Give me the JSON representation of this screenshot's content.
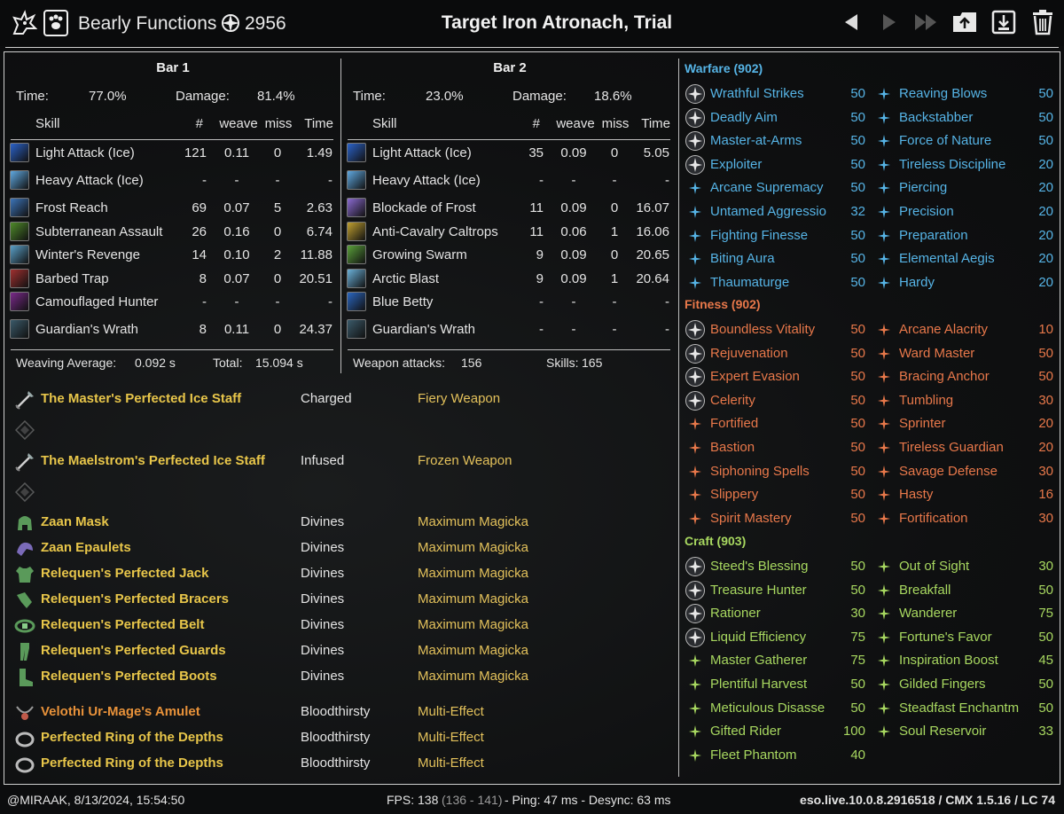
{
  "header": {
    "character": "Bearly Functions",
    "cp": "2956",
    "title": "Target Iron Atronach, Trial"
  },
  "bars": [
    {
      "title": "Bar 1",
      "time_label": "Time:",
      "time": "77.0%",
      "damage_label": "Damage:",
      "damage": "81.4%",
      "cols": [
        "Skill",
        "#",
        "weave",
        "miss",
        "Time"
      ],
      "skills": [
        {
          "name": "Light Attack (Ice)",
          "n": "121",
          "weave": "0.11",
          "miss": "0",
          "time": "1.49",
          "color": "#2b62c9"
        },
        {
          "name": "Heavy Attack (Ice)",
          "n": "-",
          "weave": "-",
          "miss": "-",
          "time": "-",
          "color": "#5fa8e0"
        },
        {
          "name": "Frost Reach",
          "n": "69",
          "weave": "0.07",
          "miss": "5",
          "time": "2.63",
          "color": "#3c74b8"
        },
        {
          "name": "Subterranean Assault",
          "n": "26",
          "weave": "0.16",
          "miss": "0",
          "time": "6.74",
          "color": "#4f8a2a"
        },
        {
          "name": "Winter's Revenge",
          "n": "14",
          "weave": "0.10",
          "miss": "2",
          "time": "11.88",
          "color": "#5aa0c8"
        },
        {
          "name": "Barbed Trap",
          "n": "8",
          "weave": "0.07",
          "miss": "0",
          "time": "20.51",
          "color": "#a03030"
        },
        {
          "name": "Camouflaged Hunter",
          "n": "-",
          "weave": "-",
          "miss": "-",
          "time": "-",
          "color": "#7a2a8a"
        },
        {
          "name": "Guardian's Wrath",
          "n": "8",
          "weave": "0.11",
          "miss": "0",
          "time": "24.37",
          "color": "#3a5a6a"
        }
      ],
      "foot_left_label": "Weaving Average:",
      "foot_left": "0.092 s",
      "foot_right_label": "Total:",
      "foot_right": "15.094 s"
    },
    {
      "title": "Bar 2",
      "time_label": "Time:",
      "time": "23.0%",
      "damage_label": "Damage:",
      "damage": "18.6%",
      "cols": [
        "Skill",
        "#",
        "weave",
        "miss",
        "Time"
      ],
      "skills": [
        {
          "name": "Light Attack (Ice)",
          "n": "35",
          "weave": "0.09",
          "miss": "0",
          "time": "5.05",
          "color": "#2b62c9"
        },
        {
          "name": "Heavy Attack (Ice)",
          "n": "-",
          "weave": "-",
          "miss": "-",
          "time": "-",
          "color": "#5fa8e0"
        },
        {
          "name": "Blockade of Frost",
          "n": "11",
          "weave": "0.09",
          "miss": "0",
          "time": "16.07",
          "color": "#8a6ad0"
        },
        {
          "name": "Anti-Cavalry Caltrops",
          "n": "11",
          "weave": "0.06",
          "miss": "1",
          "time": "16.06",
          "color": "#c0a030"
        },
        {
          "name": "Growing Swarm",
          "n": "9",
          "weave": "0.09",
          "miss": "0",
          "time": "20.65",
          "color": "#5aa03a"
        },
        {
          "name": "Arctic Blast",
          "n": "9",
          "weave": "0.09",
          "miss": "1",
          "time": "20.64",
          "color": "#6ab0d8"
        },
        {
          "name": "Blue Betty",
          "n": "-",
          "weave": "-",
          "miss": "-",
          "time": "-",
          "color": "#2a66c0"
        },
        {
          "name": "Guardian's Wrath",
          "n": "-",
          "weave": "-",
          "miss": "-",
          "time": "-",
          "color": "#3a5a6a"
        }
      ],
      "foot_left_label": "Weapon attacks:",
      "foot_left": "156",
      "foot_right_label": "Skills:",
      "foot_right": "165"
    }
  ],
  "gear": [
    {
      "name": "The Master's Perfected Ice Staff",
      "trait": "Charged",
      "ench": "Fiery Weapon",
      "icon": "staff-icon"
    },
    {
      "name": "The Maelstrom's Perfected Ice Staff",
      "trait": "Infused",
      "ench": "Frozen Weapon",
      "icon": "staff-icon"
    },
    {
      "name": "Zaan Mask",
      "trait": "Divines",
      "ench": "Maximum Magicka",
      "icon": "helm-icon"
    },
    {
      "name": "Zaan Epaulets",
      "trait": "Divines",
      "ench": "Maximum Magicka",
      "icon": "shoulder-icon"
    },
    {
      "name": "Relequen's Perfected Jack",
      "trait": "Divines",
      "ench": "Maximum Magicka",
      "icon": "chest-icon"
    },
    {
      "name": "Relequen's Perfected Bracers",
      "trait": "Divines",
      "ench": "Maximum Magicka",
      "icon": "bracers-icon"
    },
    {
      "name": "Relequen's Perfected Belt",
      "trait": "Divines",
      "ench": "Maximum Magicka",
      "icon": "belt-icon"
    },
    {
      "name": "Relequen's Perfected Guards",
      "trait": "Divines",
      "ench": "Maximum Magicka",
      "icon": "legs-icon"
    },
    {
      "name": "Relequen's Perfected Boots",
      "trait": "Divines",
      "ench": "Maximum Magicka",
      "icon": "boots-icon"
    },
    {
      "name": "Velothi Ur-Mage's Amulet",
      "trait": "Bloodthirsty",
      "ench": "Multi-Effect",
      "icon": "amulet-icon"
    },
    {
      "name": "Perfected Ring of the Depths",
      "trait": "Bloodthirsty",
      "ench": "Multi-Effect",
      "icon": "ring-icon"
    },
    {
      "name": "Perfected Ring of the Depths",
      "trait": "Bloodthirsty",
      "ench": "Multi-Effect",
      "icon": "ring-icon"
    }
  ],
  "cp_trees": [
    {
      "title": "Warfare (902)",
      "color": "#56b4e6",
      "left": [
        {
          "name": "Wrathful Strikes",
          "v": "50",
          "slotted": true
        },
        {
          "name": "Deadly Aim",
          "v": "50",
          "slotted": true
        },
        {
          "name": "Master-at-Arms",
          "v": "50",
          "slotted": true
        },
        {
          "name": "Exploiter",
          "v": "50",
          "slotted": true
        },
        {
          "name": "Arcane Supremacy",
          "v": "50",
          "slotted": false
        },
        {
          "name": "Untamed Aggressio",
          "v": "32",
          "slotted": false
        },
        {
          "name": "Fighting Finesse",
          "v": "50",
          "slotted": false
        },
        {
          "name": "Biting Aura",
          "v": "50",
          "slotted": false
        },
        {
          "name": "Thaumaturge",
          "v": "50",
          "slotted": false
        }
      ],
      "right": [
        {
          "name": "Reaving Blows",
          "v": "50"
        },
        {
          "name": "Backstabber",
          "v": "50"
        },
        {
          "name": "Force of Nature",
          "v": "50"
        },
        {
          "name": "Tireless Discipline",
          "v": "20"
        },
        {
          "name": "Piercing",
          "v": "20"
        },
        {
          "name": "Precision",
          "v": "20"
        },
        {
          "name": "Preparation",
          "v": "20"
        },
        {
          "name": "Elemental Aegis",
          "v": "20"
        },
        {
          "name": "Hardy",
          "v": "20"
        }
      ]
    },
    {
      "title": "Fitness (902)",
      "color": "#e8784a",
      "left": [
        {
          "name": "Boundless Vitality",
          "v": "50",
          "slotted": true
        },
        {
          "name": "Rejuvenation",
          "v": "50",
          "slotted": true
        },
        {
          "name": "Expert Evasion",
          "v": "50",
          "slotted": true
        },
        {
          "name": "Celerity",
          "v": "50",
          "slotted": true
        },
        {
          "name": "Fortified",
          "v": "50",
          "slotted": false
        },
        {
          "name": "Bastion",
          "v": "50",
          "slotted": false
        },
        {
          "name": "Siphoning Spells",
          "v": "50",
          "slotted": false
        },
        {
          "name": "Slippery",
          "v": "50",
          "slotted": false
        },
        {
          "name": "Spirit Mastery",
          "v": "50",
          "slotted": false
        }
      ],
      "right": [
        {
          "name": "Arcane Alacrity",
          "v": "10"
        },
        {
          "name": "Ward Master",
          "v": "50"
        },
        {
          "name": "Bracing Anchor",
          "v": "50"
        },
        {
          "name": "Tumbling",
          "v": "30"
        },
        {
          "name": "Sprinter",
          "v": "20"
        },
        {
          "name": "Tireless Guardian",
          "v": "20"
        },
        {
          "name": "Savage Defense",
          "v": "30"
        },
        {
          "name": "Hasty",
          "v": "16"
        },
        {
          "name": "Fortification",
          "v": "30"
        }
      ]
    },
    {
      "title": "Craft (903)",
      "color": "#a8d860",
      "left": [
        {
          "name": "Steed's Blessing",
          "v": "50",
          "slotted": true
        },
        {
          "name": "Treasure Hunter",
          "v": "50",
          "slotted": true
        },
        {
          "name": "Rationer",
          "v": "30",
          "slotted": true
        },
        {
          "name": "Liquid Efficiency",
          "v": "75",
          "slotted": true
        },
        {
          "name": "Master Gatherer",
          "v": "75",
          "slotted": false
        },
        {
          "name": "Plentiful Harvest",
          "v": "50",
          "slotted": false
        },
        {
          "name": "Meticulous Disasse",
          "v": "50",
          "slotted": false
        },
        {
          "name": "Gifted Rider",
          "v": "100",
          "slotted": false
        },
        {
          "name": "Fleet Phantom",
          "v": "40",
          "slotted": false
        }
      ],
      "right": [
        {
          "name": "Out of Sight",
          "v": "30"
        },
        {
          "name": "Breakfall",
          "v": "50"
        },
        {
          "name": "Wanderer",
          "v": "75"
        },
        {
          "name": "Fortune's Favor",
          "v": "50"
        },
        {
          "name": "Inspiration Boost",
          "v": "45"
        },
        {
          "name": "Gilded Fingers",
          "v": "50"
        },
        {
          "name": "Steadfast Enchantm",
          "v": "50"
        },
        {
          "name": "Soul Reservoir",
          "v": "33"
        }
      ]
    }
  ],
  "footer": {
    "left": "@MIRAAK, 8/13/2024, 15:54:50",
    "fps": "FPS: 138",
    "fps_range": "(136 - 141)",
    "ping": "- Ping: 47 ms - Desync: 63 ms",
    "right": "eso.live.10.0.8.2916518 / CMX 1.5.16 / LC 74"
  }
}
